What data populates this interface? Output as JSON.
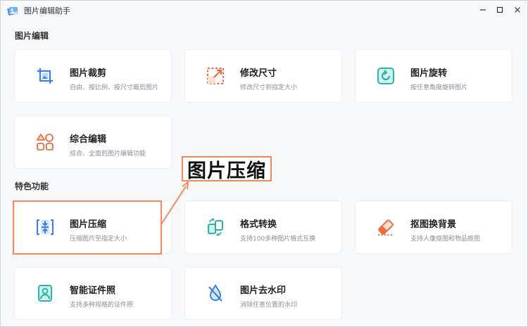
{
  "app": {
    "title": "图片编辑助手"
  },
  "window_controls": {
    "minimize": "—",
    "maximize": "☐",
    "close": "✕"
  },
  "sections": [
    {
      "title": "图片编辑"
    },
    {
      "title": "特色功能"
    }
  ],
  "cards": {
    "crop": {
      "name": "图片裁剪",
      "desc": "自由、按比例、按尺寸裁剪图片"
    },
    "resize": {
      "name": "修改尺寸",
      "desc": "修改尺寸到指定大小"
    },
    "rotate": {
      "name": "图片旋转",
      "desc": "按任意角度旋转图片"
    },
    "edit": {
      "name": "综合编辑",
      "desc": "综合、全面的图片编辑功能"
    },
    "compress": {
      "name": "图片压缩",
      "desc": "压缩图片至指定大小"
    },
    "convert": {
      "name": "格式转换",
      "desc": "支持100多种图片格式互换"
    },
    "cutout": {
      "name": "抠图换背景",
      "desc": "支持人像抠图和物品抠图"
    },
    "idphoto": {
      "name": "智能证件照",
      "desc": "支持多种规格的证件照"
    },
    "watermark": {
      "name": "图片去水印",
      "desc": "消除任意位置的水印"
    }
  },
  "annotation": {
    "callout_text": "图片压缩"
  },
  "colors": {
    "accent": "#f28a5a",
    "blue": "#3d7fe8",
    "orange": "#f26b3a",
    "teal": "#2bb3a6"
  }
}
